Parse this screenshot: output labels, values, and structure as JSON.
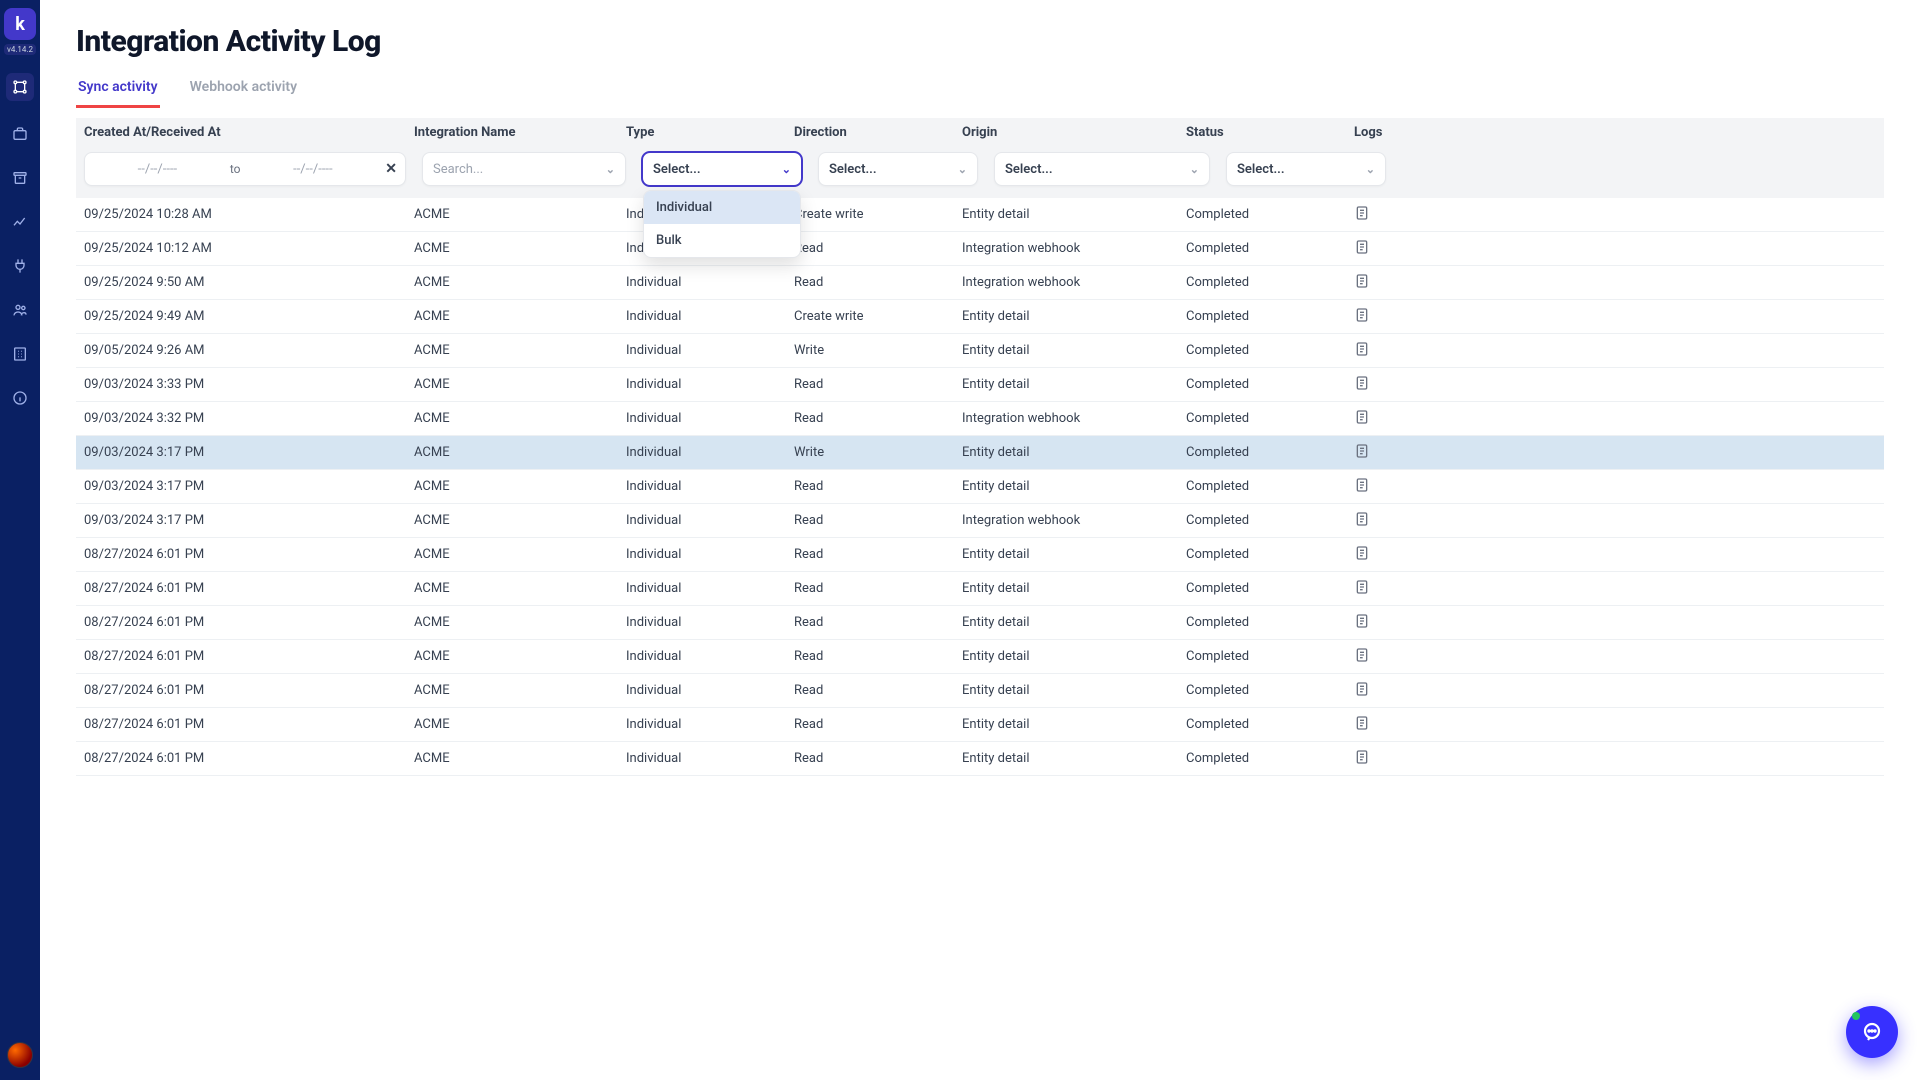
{
  "app": {
    "version": "v4.14.2"
  },
  "page": {
    "title": "Integration Activity Log"
  },
  "tabs": [
    {
      "label": "Sync activity",
      "active": true
    },
    {
      "label": "Webhook activity",
      "active": false
    }
  ],
  "columns": {
    "created": "Created At/Received At",
    "integration": "Integration Name",
    "type": "Type",
    "direction": "Direction",
    "origin": "Origin",
    "status": "Status",
    "logs": "Logs"
  },
  "filters": {
    "date_from_placeholder": "--/--/----",
    "date_to_placeholder": "--/--/----",
    "to_label": "to",
    "search_placeholder": "Search...",
    "select_placeholder": "Select...",
    "type_options": [
      "Individual",
      "Bulk"
    ]
  },
  "rows": [
    {
      "created": "09/25/2024 10:28 AM",
      "integration": "ACME",
      "type": "Individual",
      "direction": "Create write",
      "origin": "Entity detail",
      "status": "Completed",
      "highlight": false
    },
    {
      "created": "09/25/2024 10:12 AM",
      "integration": "ACME",
      "type": "Individual",
      "direction": "Read",
      "origin": "Integration webhook",
      "status": "Completed",
      "highlight": false
    },
    {
      "created": "09/25/2024 9:50 AM",
      "integration": "ACME",
      "type": "Individual",
      "direction": "Read",
      "origin": "Integration webhook",
      "status": "Completed",
      "highlight": false
    },
    {
      "created": "09/25/2024 9:49 AM",
      "integration": "ACME",
      "type": "Individual",
      "direction": "Create write",
      "origin": "Entity detail",
      "status": "Completed",
      "highlight": false
    },
    {
      "created": "09/05/2024 9:26 AM",
      "integration": "ACME",
      "type": "Individual",
      "direction": "Write",
      "origin": "Entity detail",
      "status": "Completed",
      "highlight": false
    },
    {
      "created": "09/03/2024 3:33 PM",
      "integration": "ACME",
      "type": "Individual",
      "direction": "Read",
      "origin": "Entity detail",
      "status": "Completed",
      "highlight": false
    },
    {
      "created": "09/03/2024 3:32 PM",
      "integration": "ACME",
      "type": "Individual",
      "direction": "Read",
      "origin": "Integration webhook",
      "status": "Completed",
      "highlight": false
    },
    {
      "created": "09/03/2024 3:17 PM",
      "integration": "ACME",
      "type": "Individual",
      "direction": "Write",
      "origin": "Entity detail",
      "status": "Completed",
      "highlight": true
    },
    {
      "created": "09/03/2024 3:17 PM",
      "integration": "ACME",
      "type": "Individual",
      "direction": "Read",
      "origin": "Entity detail",
      "status": "Completed",
      "highlight": false
    },
    {
      "created": "09/03/2024 3:17 PM",
      "integration": "ACME",
      "type": "Individual",
      "direction": "Read",
      "origin": "Integration webhook",
      "status": "Completed",
      "highlight": false
    },
    {
      "created": "08/27/2024 6:01 PM",
      "integration": "ACME",
      "type": "Individual",
      "direction": "Read",
      "origin": "Entity detail",
      "status": "Completed",
      "highlight": false
    },
    {
      "created": "08/27/2024 6:01 PM",
      "integration": "ACME",
      "type": "Individual",
      "direction": "Read",
      "origin": "Entity detail",
      "status": "Completed",
      "highlight": false
    },
    {
      "created": "08/27/2024 6:01 PM",
      "integration": "ACME",
      "type": "Individual",
      "direction": "Read",
      "origin": "Entity detail",
      "status": "Completed",
      "highlight": false
    },
    {
      "created": "08/27/2024 6:01 PM",
      "integration": "ACME",
      "type": "Individual",
      "direction": "Read",
      "origin": "Entity detail",
      "status": "Completed",
      "highlight": false
    },
    {
      "created": "08/27/2024 6:01 PM",
      "integration": "ACME",
      "type": "Individual",
      "direction": "Read",
      "origin": "Entity detail",
      "status": "Completed",
      "highlight": false
    },
    {
      "created": "08/27/2024 6:01 PM",
      "integration": "ACME",
      "type": "Individual",
      "direction": "Read",
      "origin": "Entity detail",
      "status": "Completed",
      "highlight": false
    },
    {
      "created": "08/27/2024 6:01 PM",
      "integration": "ACME",
      "type": "Individual",
      "direction": "Read",
      "origin": "Entity detail",
      "status": "Completed",
      "highlight": false
    }
  ],
  "sidebar_icons": [
    "network-icon",
    "briefcase-icon",
    "archive-icon",
    "chart-icon",
    "plug-icon",
    "users-icon",
    "building-icon",
    "info-icon"
  ]
}
